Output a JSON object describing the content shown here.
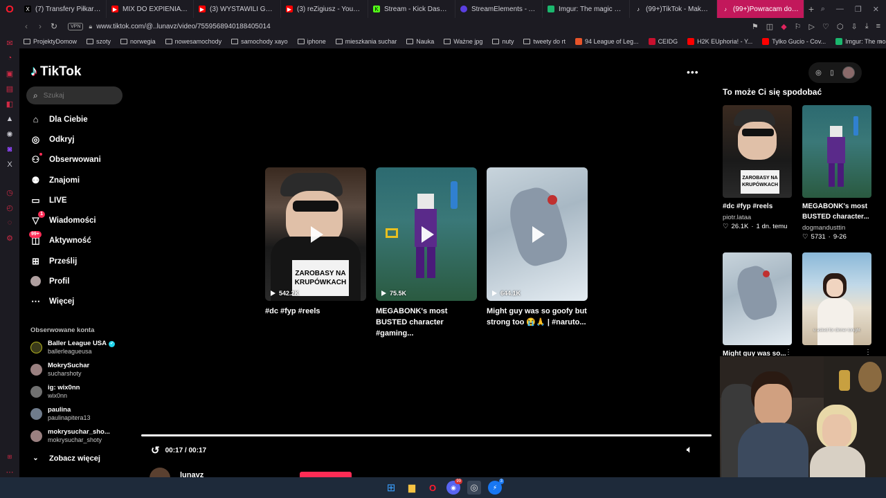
{
  "browser": {
    "tabs": [
      {
        "title": "(7) Transfery Piłkarskie w",
        "icon": "x-icon",
        "color": "#000000"
      },
      {
        "title": "MIX DO EXPIENIA W",
        "icon": "youtube-icon",
        "color": "#ff0000"
      },
      {
        "title": "(3) WYSTAWILI GO! SAB",
        "icon": "youtube-icon",
        "color": "#ff0000"
      },
      {
        "title": "(3) reZigiusz - YouTube",
        "icon": "youtube-icon",
        "color": "#ff0000"
      },
      {
        "title": "Stream - Kick Dashboard",
        "icon": "kick-icon",
        "color": "#53fc18"
      },
      {
        "title": "StreamElements - Activi",
        "icon": "streamelements-icon",
        "color": "#5a3fe0"
      },
      {
        "title": "Imgur: The magic of the",
        "icon": "imgur-icon",
        "color": "#1bb76e"
      },
      {
        "title": "(99+)TikTok - Make Your",
        "icon": "tiktok-icon",
        "color": "#000000"
      },
      {
        "title": "(99+)Powracam do robien",
        "icon": "tiktok-icon",
        "color": "#000000"
      }
    ],
    "new_tab": "+",
    "url": "www.tiktok.com/@..lunavz/video/7559568940188405014",
    "vpn_label": "VPN",
    "bookmarks": [
      {
        "label": "ProjektyDomow",
        "type": "folder"
      },
      {
        "label": "szoty",
        "type": "folder"
      },
      {
        "label": "norwegia",
        "type": "folder"
      },
      {
        "label": "nowesamochody",
        "type": "folder"
      },
      {
        "label": "samochody xayo",
        "type": "folder"
      },
      {
        "label": "iphone",
        "type": "folder"
      },
      {
        "label": "mieszkania suchar",
        "type": "folder"
      },
      {
        "label": "Nauka",
        "type": "folder"
      },
      {
        "label": "Ważne jpg",
        "type": "folder"
      },
      {
        "label": "nuty",
        "type": "folder"
      },
      {
        "label": "tweety do rt",
        "type": "folder"
      },
      {
        "label": "94 League of Leg...",
        "type": "site",
        "color": "#e8542a"
      },
      {
        "label": "CEIDG",
        "type": "site",
        "color": "#c8102e"
      },
      {
        "label": "H2K EUphoria! - Y...",
        "type": "site",
        "color": "#ff0000"
      },
      {
        "label": "Tylko Gucio - Cov...",
        "type": "site",
        "color": "#ff0000"
      },
      {
        "label": "Imgur: The most a...",
        "type": "site",
        "color": "#1bb76e"
      }
    ]
  },
  "tiktok": {
    "logo_text": "TikTok",
    "search_placeholder": "Szukaj",
    "nav": [
      {
        "label": "Dla Ciebie",
        "icon": "home-icon"
      },
      {
        "label": "Odkryj",
        "icon": "compass-icon"
      },
      {
        "label": "Obserwowani",
        "icon": "following-icon"
      },
      {
        "label": "Znajomi",
        "icon": "friends-icon"
      },
      {
        "label": "LIVE",
        "icon": "live-icon"
      },
      {
        "label": "Wiadomości",
        "icon": "messages-icon",
        "badge": "1"
      },
      {
        "label": "Aktywność",
        "icon": "activity-icon",
        "badge": "99+"
      },
      {
        "label": "Prześlij",
        "icon": "upload-icon"
      },
      {
        "label": "Profil",
        "icon": "profile-icon"
      },
      {
        "label": "Więcej",
        "icon": "more-icon"
      }
    ],
    "followed_title": "Obserwowane konta",
    "followed": [
      {
        "name": "Baller League USA",
        "user": "ballerleagueusa",
        "verified": true
      },
      {
        "name": "MokrySuchar",
        "user": "sucharshoty"
      },
      {
        "name": "ig: wix0nn",
        "user": "wix0nn"
      },
      {
        "name": "paulina",
        "user": "paulinapitera13"
      },
      {
        "name": "mokrysuchar_sho...",
        "user": "mokrysuchar_shoty"
      }
    ],
    "see_more": "Zobacz więcej",
    "videos": [
      {
        "views": "542.2K",
        "caption": "#dc #fyp #reels",
        "overlay": "ZAROBASY NA KRUPÓWKACH"
      },
      {
        "views": "75.5K",
        "caption": "MEGABONK's most BUSTED character #gaming..."
      },
      {
        "views": "644.1K",
        "caption": "Might guy was so goofy but strong too 😭🙏 | #naruto..."
      }
    ],
    "player": {
      "time": "00:17 / 00:17",
      "progress": 1.0,
      "author": "lunavz"
    },
    "recommend_title": "To może Ci się spodobać",
    "recommended": [
      {
        "caption": "#dc #fyp #reels",
        "author": "piotr.lataa",
        "likes": "26.1K",
        "date": "1 dn. temu",
        "overlay": "ZAROBASY NA KRUPÓWKACH"
      },
      {
        "caption": "MEGABONK's most BUSTED character...",
        "author": "dogmandusttin",
        "likes": "5731",
        "date": "9-26"
      },
      {
        "caption": "Might guy was so..."
      },
      {
        "caption": "",
        "overlay": "u asked for dinner tonight"
      }
    ]
  }
}
